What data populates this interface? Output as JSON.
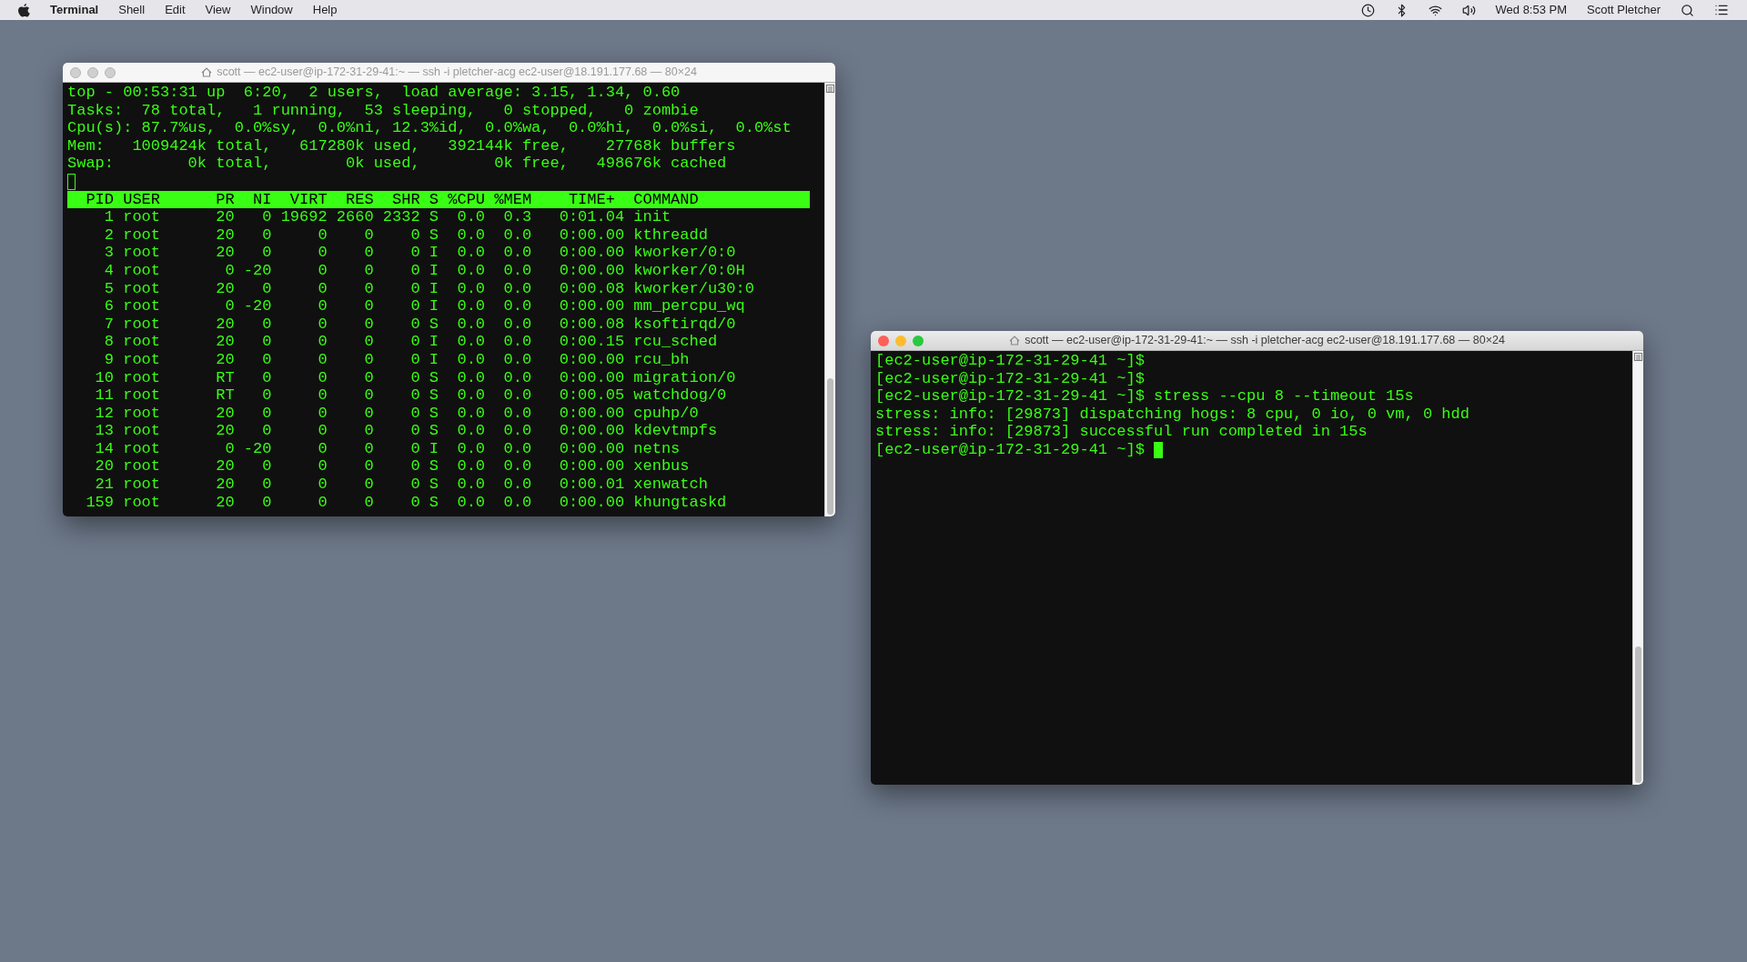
{
  "menu_bar": {
    "app_name": "Terminal",
    "items": [
      "Shell",
      "Edit",
      "View",
      "Window",
      "Help"
    ],
    "clock": "Wed 8:53 PM",
    "user": "Scott Pletcher"
  },
  "windows": [
    {
      "title": "scott — ec2-user@ip-172-31-29-41:~ — ssh -i pletcher-acg ec2-user@18.191.177.68 — 80×24",
      "active": false,
      "lines": [
        {
          "kind": "text",
          "text": "top - 00:53:31 up  6:20,  2 users,  load average: 3.15, 1.34, 0.60"
        },
        {
          "kind": "text",
          "text": "Tasks:  78 total,   1 running,  53 sleeping,   0 stopped,   0 zombie"
        },
        {
          "kind": "text",
          "text": "Cpu(s): 87.7%us,  0.0%sy,  0.0%ni, 12.3%id,  0.0%wa,  0.0%hi,  0.0%si,  0.0%st"
        },
        {
          "kind": "text",
          "text": "Mem:   1009424k total,   617280k used,   392144k free,    27768k buffers"
        },
        {
          "kind": "text",
          "text": "Swap:        0k total,        0k used,        0k free,   498676k cached"
        },
        {
          "kind": "cursor",
          "cursor": true
        },
        {
          "kind": "header",
          "text": "  PID USER      PR  NI  VIRT  RES  SHR S %CPU %MEM    TIME+  COMMAND"
        },
        {
          "kind": "text",
          "text": "    1 root      20   0 19692 2660 2332 S  0.0  0.3   0:01.04 init"
        },
        {
          "kind": "text",
          "text": "    2 root      20   0     0    0    0 S  0.0  0.0   0:00.00 kthreadd"
        },
        {
          "kind": "text",
          "text": "    3 root      20   0     0    0    0 I  0.0  0.0   0:00.00 kworker/0:0"
        },
        {
          "kind": "text",
          "text": "    4 root       0 -20     0    0    0 I  0.0  0.0   0:00.00 kworker/0:0H"
        },
        {
          "kind": "text",
          "text": "    5 root      20   0     0    0    0 I  0.0  0.0   0:00.08 kworker/u30:0"
        },
        {
          "kind": "text",
          "text": "    6 root       0 -20     0    0    0 I  0.0  0.0   0:00.00 mm_percpu_wq"
        },
        {
          "kind": "text",
          "text": "    7 root      20   0     0    0    0 S  0.0  0.0   0:00.08 ksoftirqd/0"
        },
        {
          "kind": "text",
          "text": "    8 root      20   0     0    0    0 I  0.0  0.0   0:00.15 rcu_sched"
        },
        {
          "kind": "text",
          "text": "    9 root      20   0     0    0    0 I  0.0  0.0   0:00.00 rcu_bh"
        },
        {
          "kind": "text",
          "text": "   10 root      RT   0     0    0    0 S  0.0  0.0   0:00.00 migration/0"
        },
        {
          "kind": "text",
          "text": "   11 root      RT   0     0    0    0 S  0.0  0.0   0:00.05 watchdog/0"
        },
        {
          "kind": "text",
          "text": "   12 root      20   0     0    0    0 S  0.0  0.0   0:00.00 cpuhp/0"
        },
        {
          "kind": "text",
          "text": "   13 root      20   0     0    0    0 S  0.0  0.0   0:00.00 kdevtmpfs"
        },
        {
          "kind": "text",
          "text": "   14 root       0 -20     0    0    0 I  0.0  0.0   0:00.00 netns"
        },
        {
          "kind": "text",
          "text": "   20 root      20   0     0    0    0 S  0.0  0.0   0:00.00 xenbus"
        },
        {
          "kind": "text",
          "text": "   21 root      20   0     0    0    0 S  0.0  0.0   0:00.01 xenwatch"
        },
        {
          "kind": "text",
          "text": "  159 root      20   0     0    0    0 S  0.0  0.0   0:00.00 khungtaskd"
        }
      ]
    },
    {
      "title": "scott — ec2-user@ip-172-31-29-41:~ — ssh -i pletcher-acg ec2-user@18.191.177.68 — 80×24",
      "active": true,
      "lines": [
        {
          "kind": "text",
          "text": "[ec2-user@ip-172-31-29-41 ~]$"
        },
        {
          "kind": "text",
          "text": "[ec2-user@ip-172-31-29-41 ~]$"
        },
        {
          "kind": "text",
          "text": "[ec2-user@ip-172-31-29-41 ~]$ stress --cpu 8 --timeout 15s"
        },
        {
          "kind": "text",
          "text": "stress: info: [29873] dispatching hogs: 8 cpu, 0 io, 0 vm, 0 hdd"
        },
        {
          "kind": "text",
          "text": "stress: info: [29873] successful run completed in 15s"
        },
        {
          "kind": "text",
          "text": "[ec2-user@ip-172-31-29-41 ~]$",
          "cursor": true
        }
      ]
    }
  ]
}
